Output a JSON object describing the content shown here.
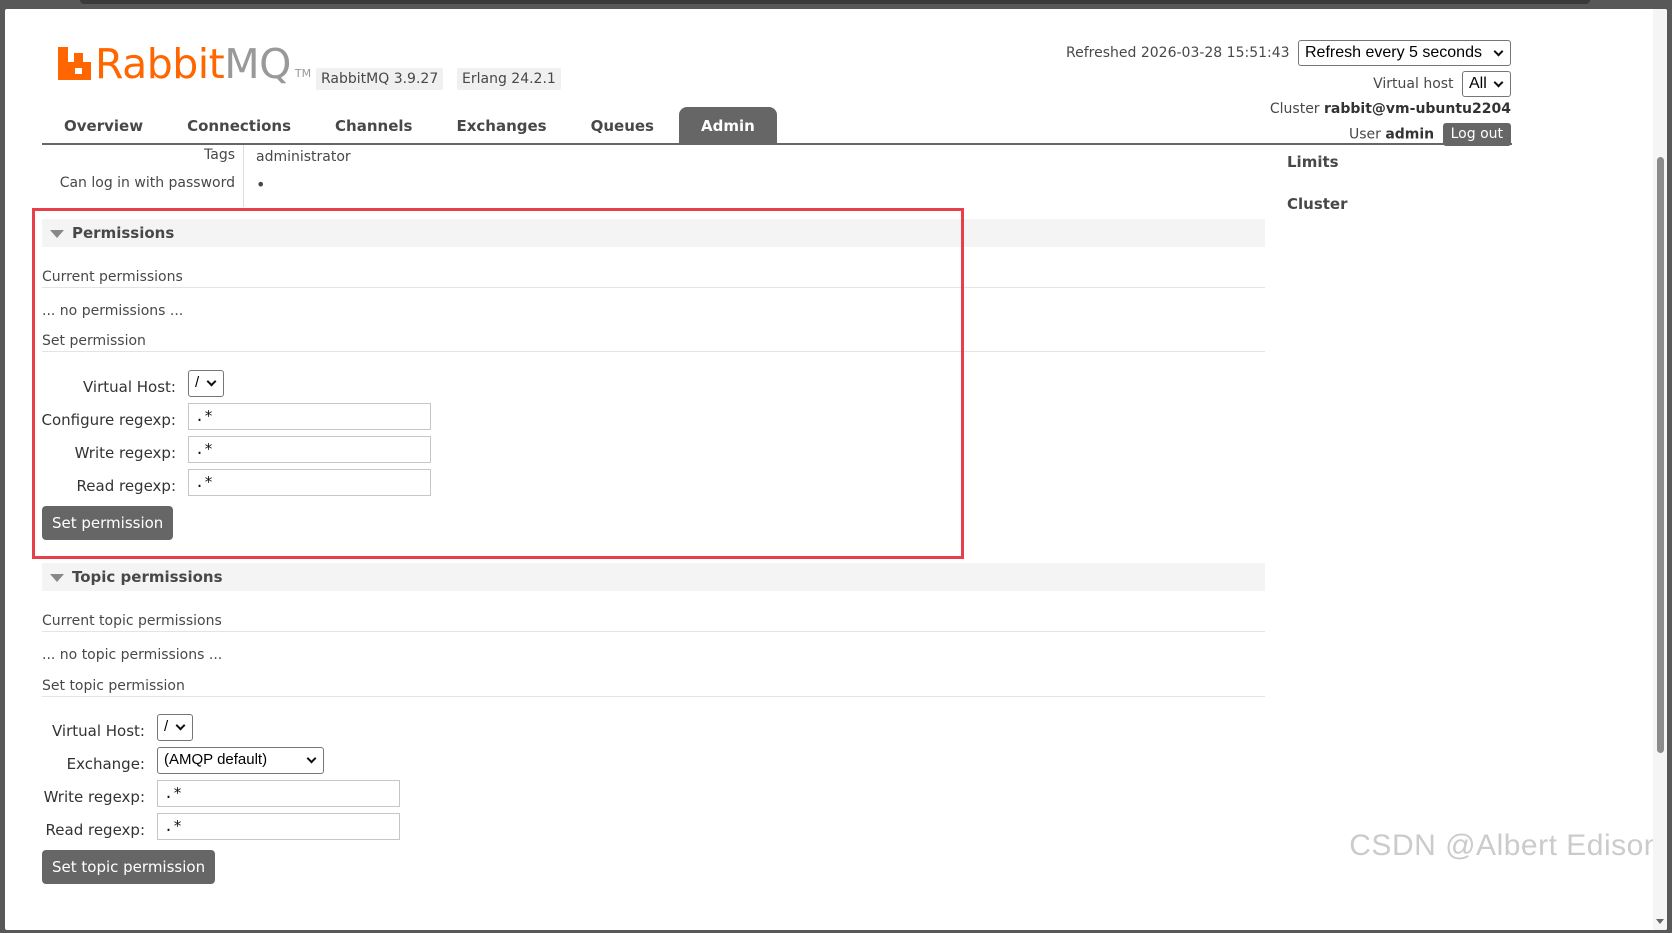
{
  "header": {
    "logo_rabbit": "Rabbit",
    "logo_mq": "MQ",
    "logo_tm": "TM",
    "rabbitmq_version": "RabbitMQ 3.9.27",
    "erlang_version": "Erlang 24.2.1",
    "refreshed_text": "Refreshed 2026-03-28 15:51:43",
    "refresh_select": "Refresh every 5 seconds",
    "vhost_label": "Virtual host",
    "vhost_select": "All",
    "cluster_label": "Cluster",
    "cluster_name": "rabbit@vm-ubuntu2204",
    "user_label": "User",
    "user_name": "admin",
    "logout_label": "Log out"
  },
  "nav": {
    "tabs": [
      "Overview",
      "Connections",
      "Channels",
      "Exchanges",
      "Queues",
      "Admin"
    ],
    "active": "Admin"
  },
  "user_summary": {
    "tags_label": "Tags",
    "tags_value": "administrator",
    "password_label": "Can log in with password",
    "password_value": "•"
  },
  "side_links": [
    "Limits",
    "Cluster"
  ],
  "permissions": {
    "title": "Permissions",
    "current_heading": "Current permissions",
    "current_empty": "... no permissions ...",
    "set_heading": "Set permission",
    "vhost_label": "Virtual Host:",
    "vhost_value": "/",
    "configure_label": "Configure regexp:",
    "configure_value": ".*",
    "write_label": "Write regexp:",
    "write_value": ".*",
    "read_label": "Read regexp:",
    "read_value": ".*",
    "button": "Set permission"
  },
  "topic_permissions": {
    "title": "Topic permissions",
    "current_heading": "Current topic permissions",
    "current_empty": "... no topic permissions ...",
    "set_heading": "Set topic permission",
    "vhost_label": "Virtual Host:",
    "vhost_value": "/",
    "exchange_label": "Exchange:",
    "exchange_value": "(AMQP default)",
    "write_label": "Write regexp:",
    "write_value": ".*",
    "read_label": "Read regexp:",
    "read_value": ".*",
    "button": "Set topic permission"
  },
  "watermark": "CSDN @Albert Edison",
  "colors": {
    "accent_orange": "#ff6600",
    "tab_active": "#666666",
    "highlight": "#e8404a"
  }
}
